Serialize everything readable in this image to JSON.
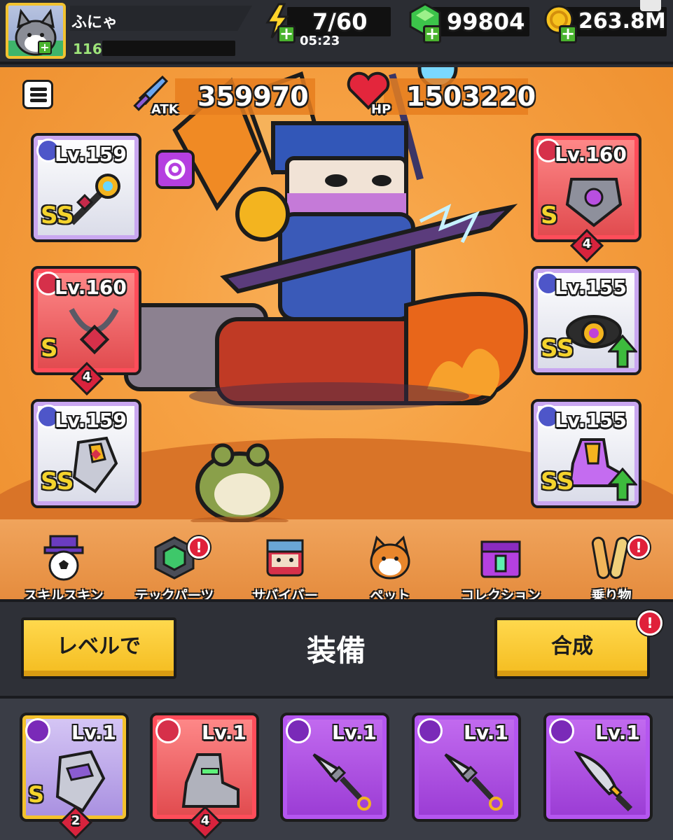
{
  "header": {
    "player_name": "ふにゃ",
    "player_level": "116",
    "energy": "7/60",
    "energy_timer": "05:23",
    "gems": "99804",
    "coins": "263.8M"
  },
  "stats": {
    "atk_label": "ATK",
    "atk_value": "359970",
    "hp_label": "HP",
    "hp_value": "1503220"
  },
  "equipped": {
    "weapon": {
      "level": "Lv.159",
      "grade": "SS"
    },
    "necklace": {
      "level": "Lv.160",
      "grade": "S",
      "stars": "4"
    },
    "gloves": {
      "level": "Lv.159",
      "grade": "SS"
    },
    "armor": {
      "level": "Lv.160",
      "grade": "S",
      "stars": "4"
    },
    "belt": {
      "level": "Lv.155",
      "grade": "SS"
    },
    "boots": {
      "level": "Lv.155",
      "grade": "SS"
    }
  },
  "categories": [
    {
      "label": "スキルスキン",
      "alert": false
    },
    {
      "label": "テックパーツ",
      "alert": true
    },
    {
      "label": "サバイバー",
      "alert": false
    },
    {
      "label": "ペット",
      "alert": false
    },
    {
      "label": "コレクション",
      "alert": false
    },
    {
      "label": "乗り物",
      "alert": true
    }
  ],
  "actions": {
    "level_button": "レベルで",
    "title": "装備",
    "merge_button": "合成",
    "merge_alert": "!"
  },
  "inventory": [
    {
      "level": "Lv.1",
      "grade": "S",
      "stars": "2",
      "type": "gloves"
    },
    {
      "level": "Lv.1",
      "stars": "4",
      "type": "boots"
    },
    {
      "level": "Lv.1",
      "type": "kunai"
    },
    {
      "level": "Lv.1",
      "type": "kunai"
    },
    {
      "level": "Lv.1",
      "type": "machete"
    }
  ],
  "alert_mark": "!",
  "plus_mark": "+",
  "colors": {
    "arena_orange": "#f6a143",
    "button_yellow": "#f4bc1f",
    "alert_red": "#e0203a",
    "plus_green": "#4ab32f",
    "epic_purple": "#9a3bd4",
    "legend_red": "#e0494d"
  }
}
